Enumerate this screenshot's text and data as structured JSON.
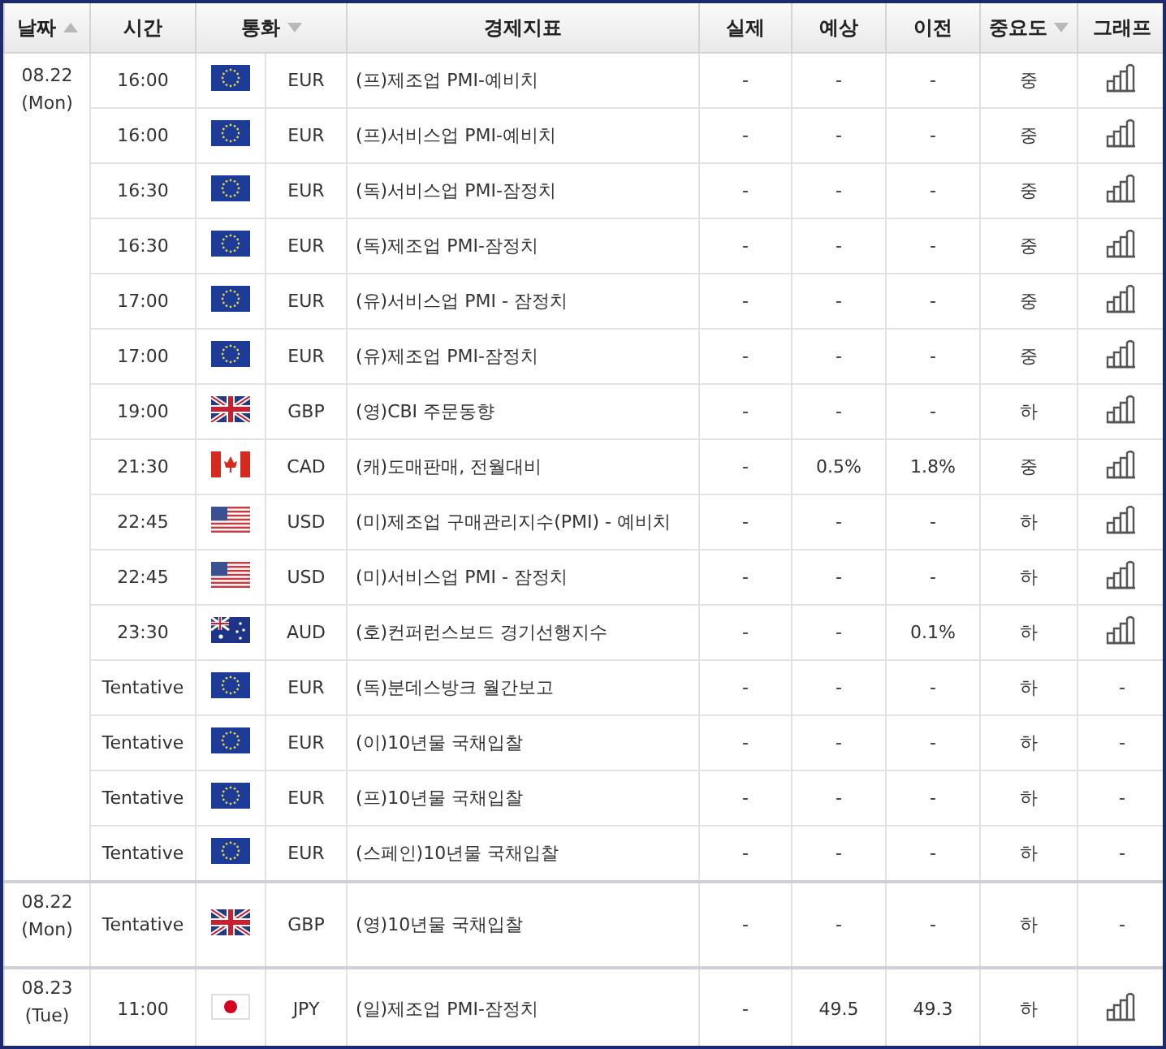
{
  "columns": [
    {
      "label": "날짜",
      "sort": {
        "kind": "asc"
      }
    },
    {
      "label": "시간"
    },
    {
      "label": "통화",
      "sort": {
        "kind": "desc"
      }
    },
    {
      "label": "경제지표"
    },
    {
      "label": "실제"
    },
    {
      "label": "예상"
    },
    {
      "label": "이전"
    },
    {
      "label": "중요도",
      "sort": {
        "kind": "desc"
      }
    },
    {
      "label": "그래프"
    }
  ],
  "groups": [
    {
      "date": "08.22",
      "weekday": "(Mon)",
      "rows": [
        {
          "time": "16:00",
          "flag": {
            "kind": "eu"
          },
          "currency": "EUR",
          "indicator": "(프)제조업 PMI-예비치",
          "actual": "-",
          "forecast": "-",
          "previous": "-",
          "importance": "중",
          "graph": {
            "kind": "icon"
          }
        },
        {
          "time": "16:00",
          "flag": {
            "kind": "eu"
          },
          "currency": "EUR",
          "indicator": "(프)서비스업 PMI-예비치",
          "actual": "-",
          "forecast": "-",
          "previous": "-",
          "importance": "중",
          "graph": {
            "kind": "icon"
          }
        },
        {
          "time": "16:30",
          "flag": {
            "kind": "eu"
          },
          "currency": "EUR",
          "indicator": "(독)서비스업 PMI-잠정치",
          "actual": "-",
          "forecast": "-",
          "previous": "-",
          "importance": "중",
          "graph": {
            "kind": "icon"
          }
        },
        {
          "time": "16:30",
          "flag": {
            "kind": "eu"
          },
          "currency": "EUR",
          "indicator": "(독)제조업 PMI-잠정치",
          "actual": "-",
          "forecast": "-",
          "previous": "-",
          "importance": "중",
          "graph": {
            "kind": "icon"
          }
        },
        {
          "time": "17:00",
          "flag": {
            "kind": "eu"
          },
          "currency": "EUR",
          "indicator": "(유)서비스업 PMI - 잠정치",
          "actual": "-",
          "forecast": "-",
          "previous": "-",
          "importance": "중",
          "graph": {
            "kind": "icon"
          }
        },
        {
          "time": "17:00",
          "flag": {
            "kind": "eu"
          },
          "currency": "EUR",
          "indicator": "(유)제조업 PMI-잠정치",
          "actual": "-",
          "forecast": "-",
          "previous": "-",
          "importance": "중",
          "graph": {
            "kind": "icon"
          }
        },
        {
          "time": "19:00",
          "flag": {
            "kind": "uk"
          },
          "currency": "GBP",
          "indicator": "(영)CBI 주문동향",
          "actual": "-",
          "forecast": "-",
          "previous": "-",
          "importance": "하",
          "graph": {
            "kind": "icon"
          }
        },
        {
          "time": "21:30",
          "flag": {
            "kind": "ca"
          },
          "currency": "CAD",
          "indicator": "(캐)도매판매, 전월대비",
          "actual": "-",
          "forecast": "0.5%",
          "previous": "1.8%",
          "importance": "중",
          "graph": {
            "kind": "icon"
          }
        },
        {
          "time": "22:45",
          "flag": {
            "kind": "us"
          },
          "currency": "USD",
          "indicator": "(미)제조업 구매관리지수(PMI) - 예비치",
          "actual": "-",
          "forecast": "-",
          "previous": "-",
          "importance": "하",
          "graph": {
            "kind": "icon"
          }
        },
        {
          "time": "22:45",
          "flag": {
            "kind": "us"
          },
          "currency": "USD",
          "indicator": "(미)서비스업 PMI - 잠정치",
          "actual": "-",
          "forecast": "-",
          "previous": "-",
          "importance": "하",
          "graph": {
            "kind": "icon"
          }
        },
        {
          "time": "23:30",
          "flag": {
            "kind": "au"
          },
          "currency": "AUD",
          "indicator": "(호)컨퍼런스보드 경기선행지수",
          "actual": "-",
          "forecast": "-",
          "previous": "0.1%",
          "importance": "하",
          "graph": {
            "kind": "icon"
          }
        },
        {
          "time": "Tentative",
          "flag": {
            "kind": "eu"
          },
          "currency": "EUR",
          "indicator": "(독)분데스방크 월간보고",
          "actual": "-",
          "forecast": "-",
          "previous": "-",
          "importance": "하",
          "graph": {
            "kind": "text",
            "text": "-"
          }
        },
        {
          "time": "Tentative",
          "flag": {
            "kind": "eu"
          },
          "currency": "EUR",
          "indicator": "(이)10년물 국채입찰",
          "actual": "-",
          "forecast": "-",
          "previous": "-",
          "importance": "하",
          "graph": {
            "kind": "text",
            "text": "-"
          }
        },
        {
          "time": "Tentative",
          "flag": {
            "kind": "eu"
          },
          "currency": "EUR",
          "indicator": "(프)10년물 국채입찰",
          "actual": "-",
          "forecast": "-",
          "previous": "-",
          "importance": "하",
          "graph": {
            "kind": "text",
            "text": "-"
          }
        },
        {
          "time": "Tentative",
          "flag": {
            "kind": "eu"
          },
          "currency": "EUR",
          "indicator": "(스페인)10년물 국채입찰",
          "actual": "-",
          "forecast": "-",
          "previous": "-",
          "importance": "하",
          "graph": {
            "kind": "text",
            "text": "-"
          }
        }
      ]
    },
    {
      "date": "08.22",
      "weekday": "(Mon)",
      "rows": [
        {
          "time": "Tentative",
          "flag": {
            "kind": "uk"
          },
          "currency": "GBP",
          "indicator": "(영)10년물 국채입찰",
          "actual": "-",
          "forecast": "-",
          "previous": "-",
          "importance": "하",
          "graph": {
            "kind": "text",
            "text": "-"
          }
        }
      ]
    },
    {
      "date": "08.23",
      "weekday": "(Tue)",
      "rows": [
        {
          "time": "11:00",
          "flag": {
            "kind": "jp"
          },
          "currency": "JPY",
          "indicator": "(일)제조업 PMI-잠정치",
          "actual": "-",
          "forecast": "49.5",
          "previous": "49.3",
          "importance": "하",
          "graph": {
            "kind": "icon"
          }
        }
      ]
    }
  ]
}
